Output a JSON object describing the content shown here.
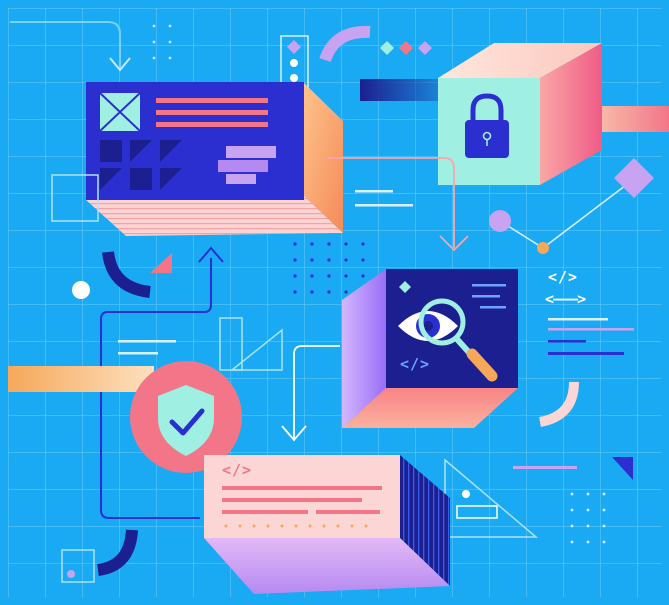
{
  "colors": {
    "background": "#1aaaf3",
    "grid": "#5cc6f7",
    "navy": "#1b1f8f",
    "indigo": "#2b2fd0",
    "coral": "#f27688",
    "peach": "#f9bf8b",
    "orange": "#f6a85a",
    "mint": "#9ff0e2",
    "lavender": "#c7a3f2",
    "pink_cream": "#fbd6d4",
    "white": "#ffffff"
  },
  "code_tags": {
    "right_top": "</>",
    "right_bottom": "<———>",
    "inspector_panel": "</>",
    "bottom_card": "</>"
  },
  "icons": {
    "lock": "padlock-icon",
    "security": "shield-check-icon",
    "inspect": "eye-magnifier-icon"
  }
}
